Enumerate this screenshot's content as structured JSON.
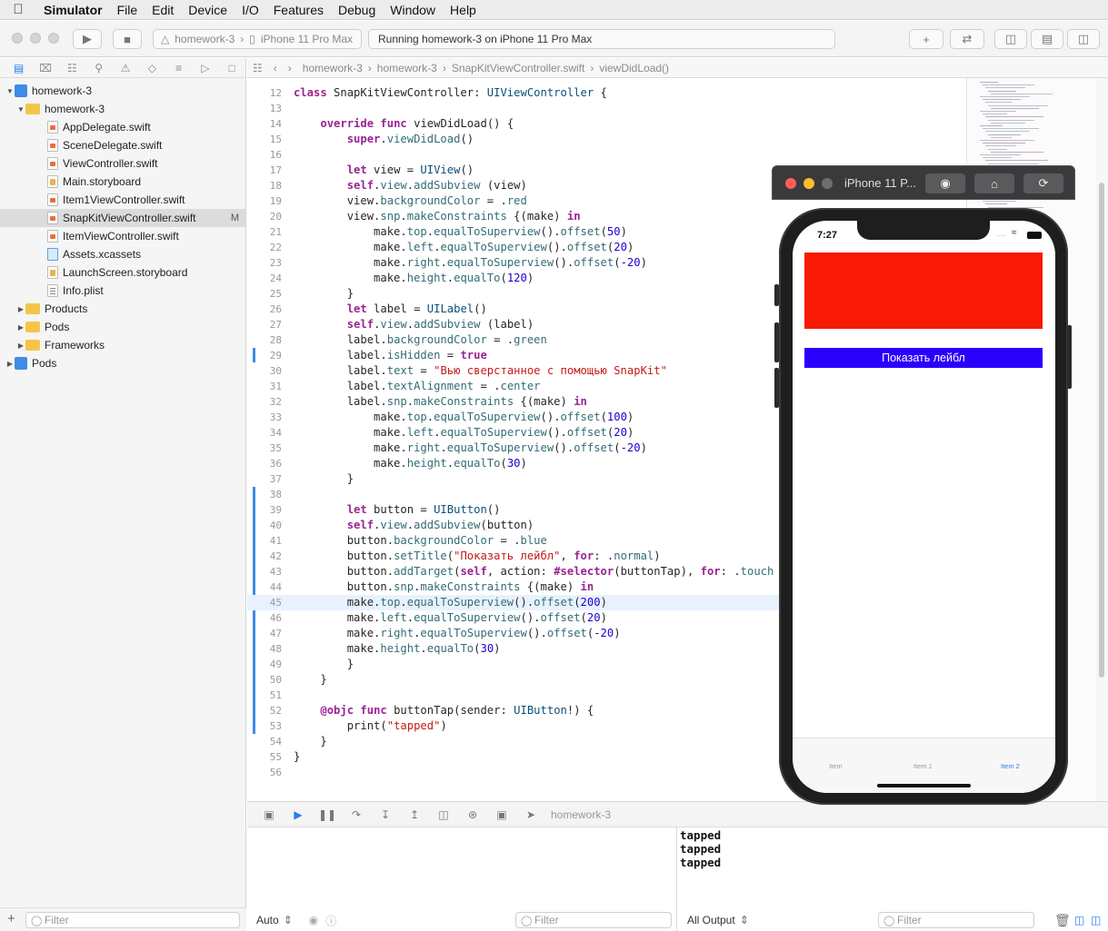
{
  "menubar": {
    "app": "Simulator",
    "items": [
      "File",
      "Edit",
      "Device",
      "I/O",
      "Features",
      "Debug",
      "Window",
      "Help"
    ]
  },
  "toolbar": {
    "scheme_project": "homework-3",
    "scheme_device": "iPhone 11 Pro Max",
    "status": "Running homework-3 on iPhone 11 Pro Max"
  },
  "navigator": {
    "rows": [
      {
        "label": "homework-3",
        "kind": "project",
        "level": 0,
        "expanded": true
      },
      {
        "label": "homework-3",
        "kind": "folder",
        "level": 1,
        "expanded": true
      },
      {
        "label": "AppDelegate.swift",
        "kind": "swift",
        "level": 2
      },
      {
        "label": "SceneDelegate.swift",
        "kind": "swift",
        "level": 2
      },
      {
        "label": "ViewController.swift",
        "kind": "swift",
        "level": 2
      },
      {
        "label": "Main.storyboard",
        "kind": "sb",
        "level": 2
      },
      {
        "label": "Item1ViewController.swift",
        "kind": "swift",
        "level": 2
      },
      {
        "label": "SnapKitViewController.swift",
        "kind": "swift",
        "level": 2,
        "selected": true,
        "badge": "M"
      },
      {
        "label": "ItemViewController.swift",
        "kind": "swift",
        "level": 2
      },
      {
        "label": "Assets.xcassets",
        "kind": "assets",
        "level": 2
      },
      {
        "label": "LaunchScreen.storyboard",
        "kind": "sb",
        "level": 2
      },
      {
        "label": "Info.plist",
        "kind": "plist",
        "level": 2
      },
      {
        "label": "Products",
        "kind": "folder",
        "level": 1,
        "expanded": false
      },
      {
        "label": "Pods",
        "kind": "folder",
        "level": 1,
        "expanded": false
      },
      {
        "label": "Frameworks",
        "kind": "folder",
        "level": 1,
        "expanded": false
      },
      {
        "label": "Pods",
        "kind": "project-blue",
        "level": 0,
        "expanded": false
      }
    ],
    "filter_placeholder": "Filter"
  },
  "jumpbar": {
    "crumbs": [
      "homework-3",
      "homework-3",
      "SnapKitViewController.swift",
      "viewDidLoad()"
    ]
  },
  "editor": {
    "current_line": 45,
    "lines": [
      {
        "n": 12,
        "t": "class SnapKitViewController: UIViewController {"
      },
      {
        "n": 13,
        "t": ""
      },
      {
        "n": 14,
        "t": "    override func viewDidLoad() {"
      },
      {
        "n": 15,
        "t": "        super.viewDidLoad()"
      },
      {
        "n": 16,
        "t": ""
      },
      {
        "n": 17,
        "t": "        let view = UIView()"
      },
      {
        "n": 18,
        "t": "        self.view.addSubview (view)"
      },
      {
        "n": 19,
        "t": "        view.backgroundColor = .red"
      },
      {
        "n": 20,
        "t": "        view.snp.makeConstraints {(make) in"
      },
      {
        "n": 21,
        "t": "            make.top.equalToSuperview().offset(50)"
      },
      {
        "n": 22,
        "t": "            make.left.equalToSuperview().offset(20)"
      },
      {
        "n": 23,
        "t": "            make.right.equalToSuperview().offset(-20)"
      },
      {
        "n": 24,
        "t": "            make.height.equalTo(120)"
      },
      {
        "n": 25,
        "t": "        }"
      },
      {
        "n": 26,
        "t": "        let label = UILabel()"
      },
      {
        "n": 27,
        "t": "        self.view.addSubview (label)"
      },
      {
        "n": 28,
        "t": "        label.backgroundColor = .green"
      },
      {
        "n": 29,
        "t": "        label.isHidden = true"
      },
      {
        "n": 30,
        "t": "        label.text = \"Вью сверстанное с помощью SnapKit\""
      },
      {
        "n": 31,
        "t": "        label.textAlignment = .center"
      },
      {
        "n": 32,
        "t": "        label.snp.makeConstraints {(make) in"
      },
      {
        "n": 33,
        "t": "            make.top.equalToSuperview().offset(100)"
      },
      {
        "n": 34,
        "t": "            make.left.equalToSuperview().offset(20)"
      },
      {
        "n": 35,
        "t": "            make.right.equalToSuperview().offset(-20)"
      },
      {
        "n": 36,
        "t": "            make.height.equalTo(30)"
      },
      {
        "n": 37,
        "t": "        }"
      },
      {
        "n": 38,
        "t": ""
      },
      {
        "n": 39,
        "t": "        let button = UIButton()"
      },
      {
        "n": 40,
        "t": "        self.view.addSubview(button)"
      },
      {
        "n": 41,
        "t": "        button.backgroundColor = .blue"
      },
      {
        "n": 42,
        "t": "        button.setTitle(\"Показать лейбл\", for: .normal)"
      },
      {
        "n": 43,
        "t": "        button.addTarget(self, action: #selector(buttonTap), for: .touch"
      },
      {
        "n": 44,
        "t": "        button.snp.makeConstraints {(make) in"
      },
      {
        "n": 45,
        "t": "        make.top.equalToSuperview().offset(200)"
      },
      {
        "n": 46,
        "t": "        make.left.equalToSuperview().offset(20)"
      },
      {
        "n": 47,
        "t": "        make.right.equalToSuperview().offset(-20)"
      },
      {
        "n": 48,
        "t": "        make.height.equalTo(30)"
      },
      {
        "n": 49,
        "t": "        }"
      },
      {
        "n": 50,
        "t": "    }"
      },
      {
        "n": 51,
        "t": ""
      },
      {
        "n": 52,
        "t": "    @objc func buttonTap(sender: UIButton!) {"
      },
      {
        "n": 53,
        "t": "        print(\"tapped\")"
      },
      {
        "n": 54,
        "t": "    }"
      },
      {
        "n": 55,
        "t": "}"
      },
      {
        "n": 56,
        "t": ""
      }
    ]
  },
  "debugbar": {
    "target": "homework-3"
  },
  "variables": {
    "scope": "Auto",
    "filter_placeholder": "Filter"
  },
  "console": {
    "output": [
      "tapped",
      "tapped",
      "tapped"
    ],
    "mode": "All Output",
    "filter_placeholder": "Filter"
  },
  "simulator": {
    "title": "iPhone 11 P...",
    "time": "7:27",
    "red_color": "#f81a05",
    "button_color": "#2a00fb",
    "button_label": "Показать лейбл",
    "tabs": [
      "Item",
      "Item 1",
      "Item 2"
    ],
    "active_tab": 2
  }
}
